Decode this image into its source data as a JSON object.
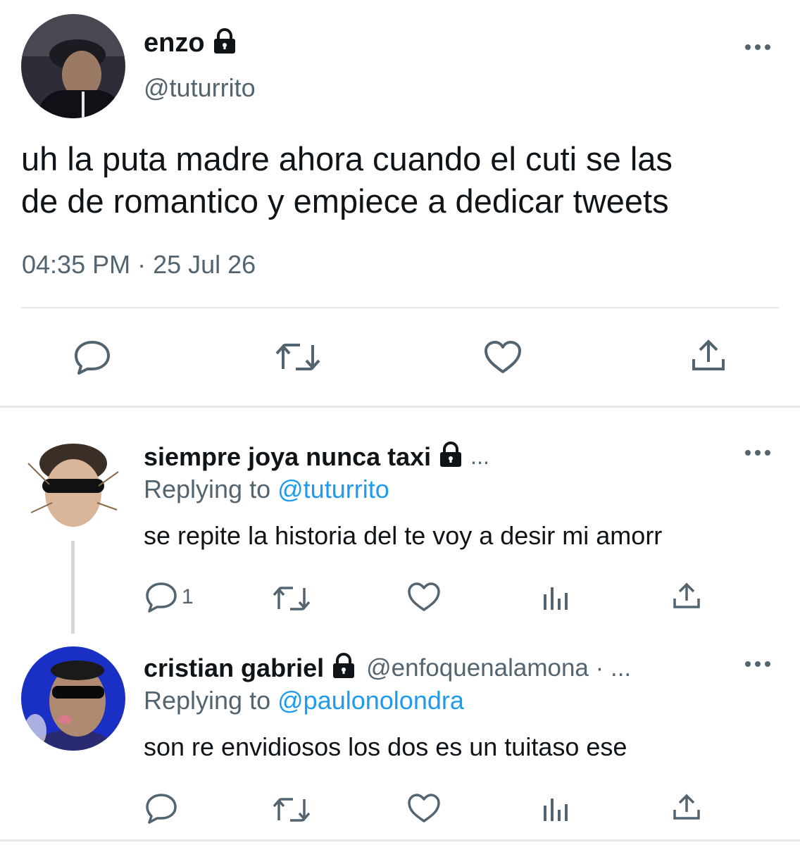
{
  "main_tweet": {
    "name": "enzo",
    "handle": "@tuturrito",
    "text_line1": "uh la puta madre ahora cuando el cuti se las",
    "text_line2": "de de romantico y empiece a dedicar tweets",
    "timestamp": "04:35 PM · 25 Jul 26"
  },
  "reply1": {
    "name": "siempre joya nunca taxi",
    "ellipsis": "...",
    "replying_prefix": "Replying to",
    "replying_to": "@tuturrito",
    "text": "se repite la historia del te voy a desir mi amorr",
    "reply_count": "1"
  },
  "reply2": {
    "name": "cristian gabriel",
    "handle": "@enfoquenalamona · ...",
    "replying_prefix": "Replying to",
    "replying_to": "@paulonolondra",
    "text": "son re envidiosos los dos es un tuitaso ese"
  },
  "colors": {
    "text": "#0f1419",
    "muted": "#536471",
    "link": "#1d9bf0",
    "divider": "#e6e9eb"
  },
  "icons": [
    "lock-icon",
    "more-icon",
    "reply-icon",
    "retweet-icon",
    "like-icon",
    "share-icon",
    "views-icon"
  ]
}
